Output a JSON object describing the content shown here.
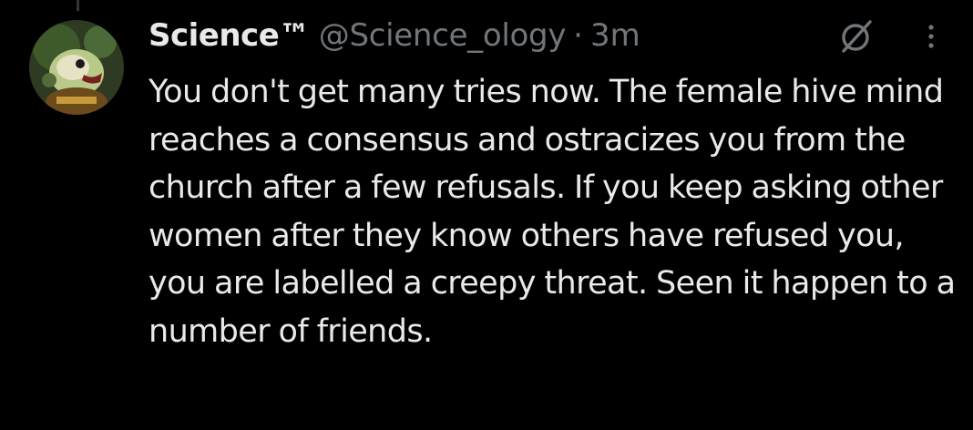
{
  "tweet": {
    "author_name": "Science™",
    "handle": "@Science_ology",
    "separator": "·",
    "time": "3m",
    "text": "You don't get many tries now. The female hive mind reaches a consensus and ostracizes you from the church after a few refusals. If you keep asking other women after they know others have refused you, you are labelled a creepy threat. Seen it happen to a number of friends."
  },
  "icons": {
    "grok": "grok-icon",
    "more": "more-options-icon",
    "avatar": "avatar"
  },
  "colors": {
    "background": "#000000",
    "primary_text": "#e7e9ea",
    "secondary_text": "#71767b"
  }
}
